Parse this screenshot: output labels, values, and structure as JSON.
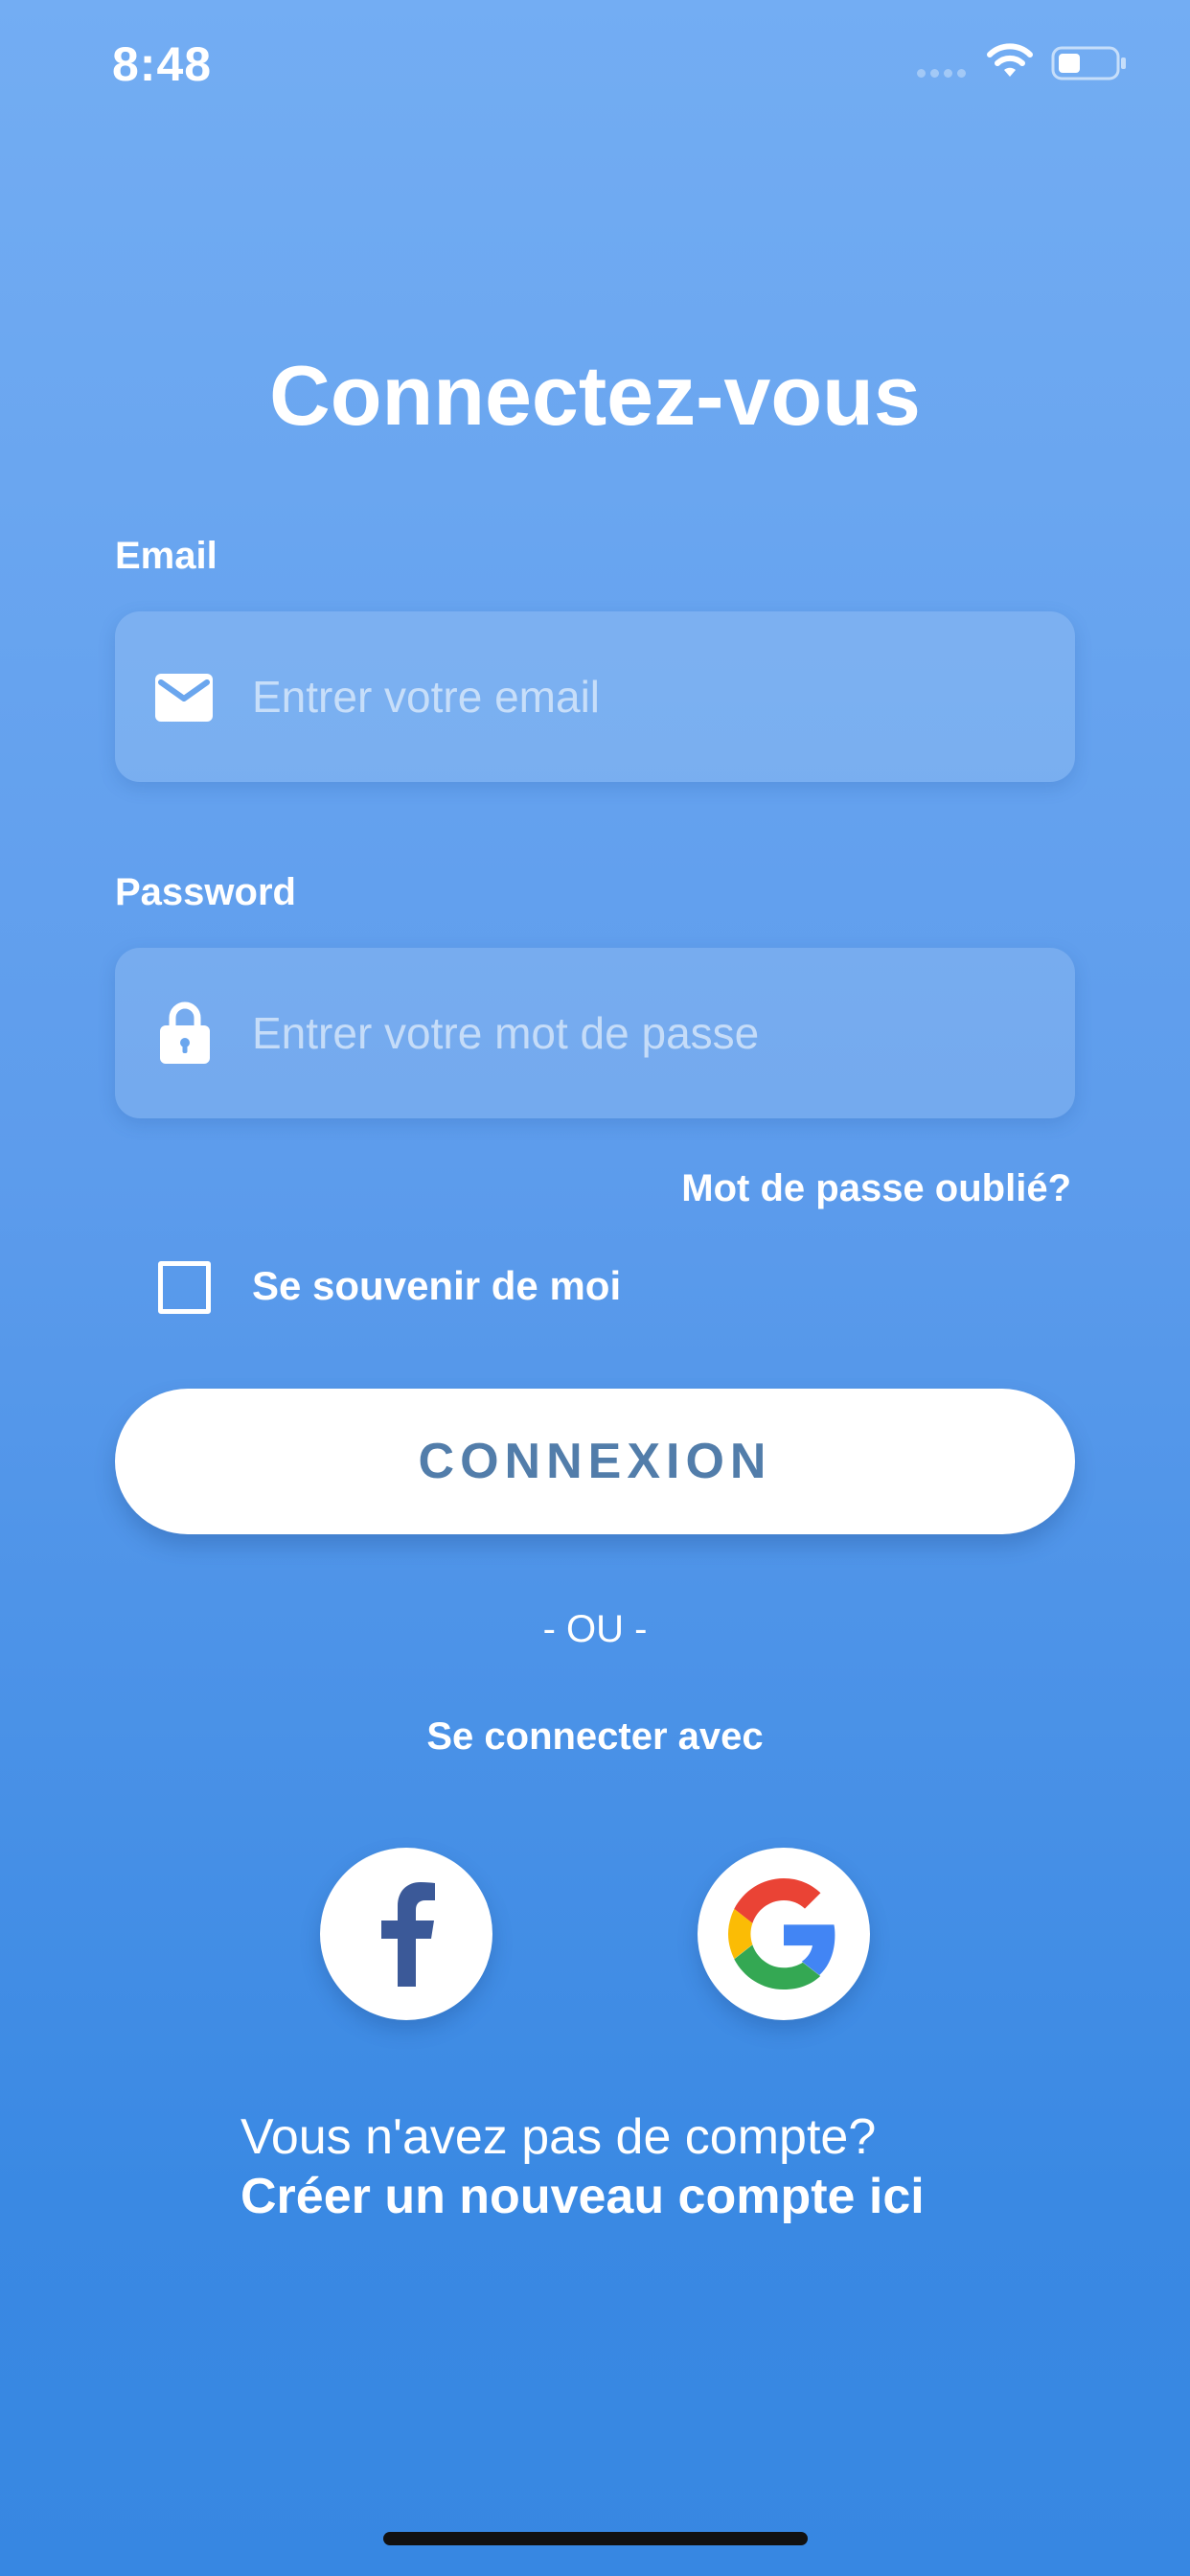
{
  "status_bar": {
    "time": "8:48",
    "icons": [
      "cellular-signal-icon",
      "wifi-icon",
      "battery-icon"
    ]
  },
  "title": "Connectez-vous",
  "email": {
    "label": "Email",
    "placeholder": "Entrer votre email",
    "value": "",
    "icon": "envelope-icon"
  },
  "password": {
    "label": "Password",
    "placeholder": "Entrer votre mot de passe",
    "value": "",
    "icon": "lock-icon"
  },
  "forgot_password": "Mot de passe oublié?",
  "remember_me": {
    "label": "Se souvenir de moi",
    "checked": false
  },
  "login_button": "CONNEXION",
  "divider_text": "- OU -",
  "social": {
    "heading": "Se connecter avec",
    "providers": [
      "facebook-icon",
      "google-icon"
    ]
  },
  "signup": {
    "prompt": "Vous n'avez pas de compte?",
    "link": "Créer un nouveau compte ici"
  },
  "colors": {
    "background_top": "#73adf3",
    "background_bottom": "#3787e2",
    "button_text": "#527daa",
    "facebook": "#3b5998"
  }
}
